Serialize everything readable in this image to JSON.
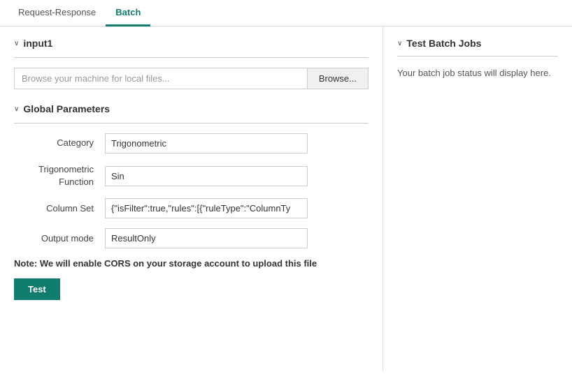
{
  "tabs": {
    "items": [
      {
        "id": "request-response",
        "label": "Request-Response",
        "active": false
      },
      {
        "id": "batch",
        "label": "Batch",
        "active": true
      }
    ]
  },
  "left": {
    "input_section": {
      "title": "input1",
      "chevron": "∨",
      "file_placeholder": "Browse your machine for local files...",
      "browse_label": "Browse..."
    },
    "global_params": {
      "title": "Global Parameters",
      "chevron": "∨",
      "params": [
        {
          "label": "Category",
          "value": "Trigonometric"
        },
        {
          "label": "Trigonometric\nFunction",
          "value": "Sin"
        },
        {
          "label": "Column Set",
          "value": "{\"isFilter\":true,\"rules\":[{\"ruleType\":\"ColumnTy"
        },
        {
          "label": "Output mode",
          "value": "ResultOnly"
        }
      ]
    },
    "note": "Note: We will enable CORS on your storage account to upload this file",
    "test_button": "Test"
  },
  "right": {
    "title": "Test Batch Jobs",
    "chevron": "∨",
    "status_text": "Your batch job status will display here."
  }
}
